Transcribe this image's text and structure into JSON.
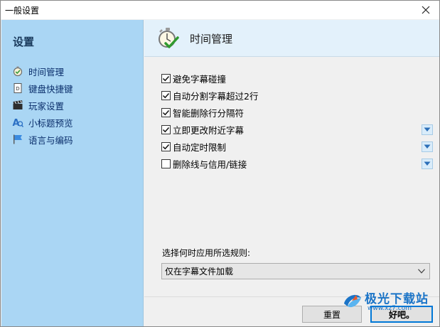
{
  "window": {
    "title": "一般设置"
  },
  "sidebar": {
    "title": "设置",
    "items": [
      {
        "label": "时间管理",
        "icon": "stopwatch-icon"
      },
      {
        "label": "键盘快捷键",
        "icon": "keyboard-doc-icon"
      },
      {
        "label": "玩家设置",
        "icon": "clapperboard-icon"
      },
      {
        "label": "小标题预览",
        "icon": "preview-icon"
      },
      {
        "label": "语言与编码",
        "icon": "flag-icon"
      }
    ]
  },
  "main": {
    "header_title": "时间管理",
    "header_icon": "stopwatch-check-icon",
    "options": [
      {
        "label": "避免字幕碰撞",
        "checked": true,
        "has_dropdown": false
      },
      {
        "label": "自动分割字幕超过2行",
        "checked": true,
        "has_dropdown": false
      },
      {
        "label": "智能删除行分隔符",
        "checked": true,
        "has_dropdown": false
      },
      {
        "label": "立即更改附近字幕",
        "checked": true,
        "has_dropdown": true
      },
      {
        "label": "自动定时限制",
        "checked": true,
        "has_dropdown": true
      },
      {
        "label": "删除线与信用/链接",
        "checked": false,
        "has_dropdown": true
      }
    ],
    "rule_label": "选择何时应用所选规则:",
    "rule_select_value": "仅在字幕文件加载"
  },
  "footer": {
    "reset_label": "重置",
    "ok_label": "好吧。"
  },
  "watermark": {
    "text": "极光下载站",
    "url": "www.xz7.com"
  },
  "colors": {
    "sidebar_bg": "#aad6f4",
    "header_bg": "#e3f1fb",
    "accent": "#0078d7"
  }
}
